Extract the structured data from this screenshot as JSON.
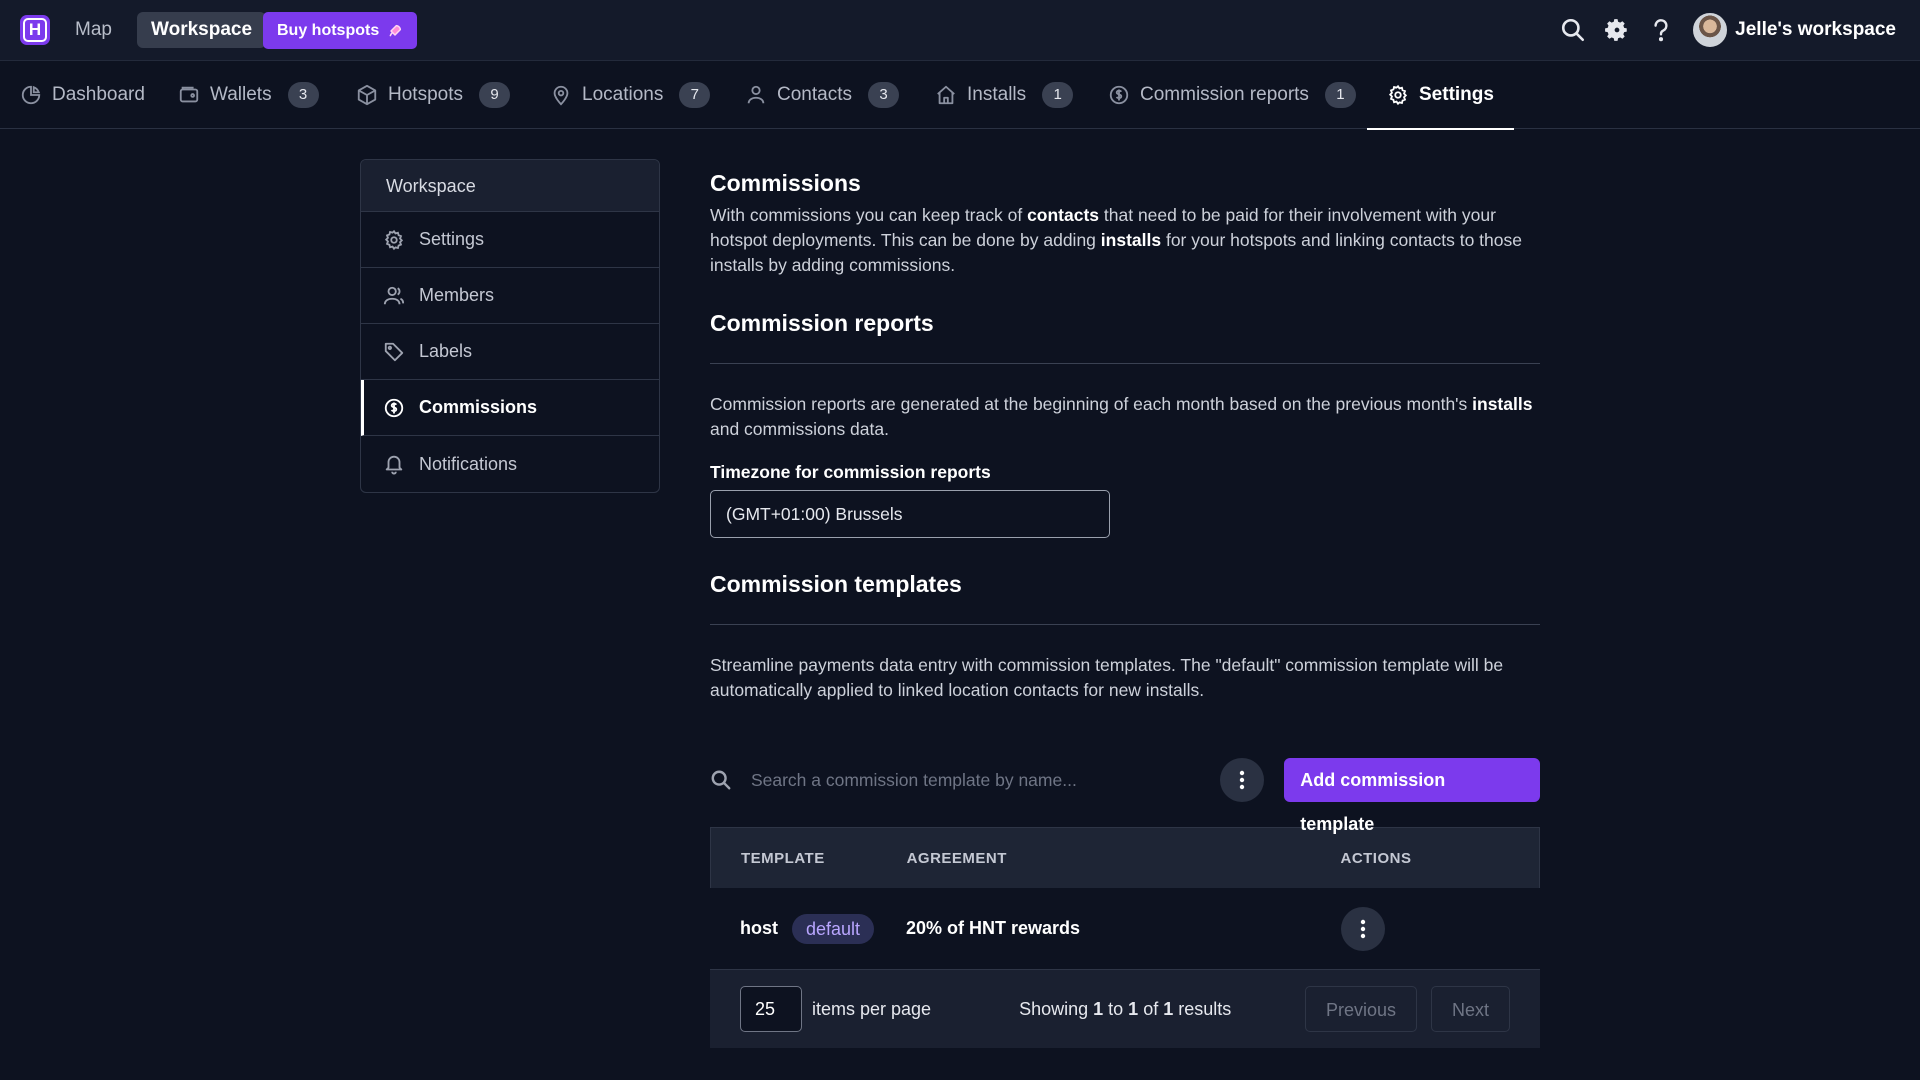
{
  "topbar": {
    "logo_letter": "H",
    "map_label": "Map",
    "workspace_label": "Workspace",
    "buy_label": "Buy hotspots",
    "workspace_name": "Jelle's workspace"
  },
  "tabs": [
    {
      "label": "Dashboard",
      "count": null,
      "icon": "pie-chart-icon"
    },
    {
      "label": "Wallets",
      "count": "3",
      "icon": "wallet-icon"
    },
    {
      "label": "Hotspots",
      "count": "9",
      "icon": "cube-icon"
    },
    {
      "label": "Locations",
      "count": "7",
      "icon": "map-pin-icon"
    },
    {
      "label": "Contacts",
      "count": "3",
      "icon": "user-icon"
    },
    {
      "label": "Installs",
      "count": "1",
      "icon": "home-icon"
    },
    {
      "label": "Commission reports",
      "count": "1",
      "icon": "dollar-circle-icon"
    },
    {
      "label": "Settings",
      "count": null,
      "icon": "gear-icon"
    }
  ],
  "sidenav": {
    "header": "Workspace",
    "items": [
      {
        "label": "Settings",
        "icon": "gear-icon"
      },
      {
        "label": "Members",
        "icon": "users-icon"
      },
      {
        "label": "Labels",
        "icon": "tag-icon"
      },
      {
        "label": "Commissions",
        "icon": "dollar-circle-icon"
      },
      {
        "label": "Notifications",
        "icon": "bell-icon"
      }
    ],
    "active_index": 3
  },
  "main": {
    "commissions": {
      "title": "Commissions",
      "text_1": "With commissions you can keep track of ",
      "bold_1": "contacts",
      "text_2": " that need to be paid for their involvement with your hotspot deployments. This can be done by adding ",
      "bold_2": "installs",
      "text_3": " for your hotspots and linking contacts to those installs by adding commissions."
    },
    "reports": {
      "title": "Commission reports",
      "text_1": "Commission reports are generated at the beginning of each month based on the previous month's ",
      "bold_1": "installs",
      "text_2": " and commissions data.",
      "timezone_label": "Timezone for commission reports",
      "timezone_value": "(GMT+01:00) Brussels"
    },
    "templates": {
      "title": "Commission templates",
      "text": "Streamline payments data entry with commission templates. The \"default\" commission template will be automatically applied to linked location contacts for new installs.",
      "search_placeholder": "Search a commission template by name...",
      "add_label": "Add commission template",
      "columns": [
        "TEMPLATE",
        "AGREEMENT",
        "ACTIONS"
      ],
      "rows": [
        {
          "name": "host",
          "badge": "default",
          "agreement": "20% of HNT rewards"
        }
      ],
      "footer": {
        "per_page": "25",
        "per_page_label": "items per page",
        "showing_prefix": "Showing ",
        "from": "1",
        "to_word": " to ",
        "to": "1",
        "of_word": " of ",
        "total": "1",
        "results_word": " results",
        "previous_label": "Previous",
        "next_label": "Next"
      }
    }
  }
}
